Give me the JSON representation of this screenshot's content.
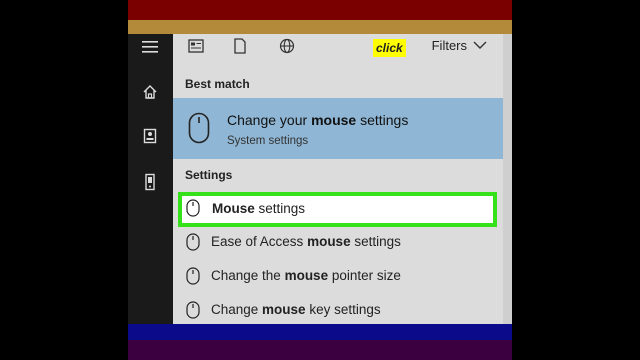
{
  "toolbar": {
    "click_label": "click",
    "filters_label": "Filters",
    "icons": [
      "doc-text-icon",
      "document-icon",
      "globe-icon"
    ]
  },
  "best_match": {
    "heading": "Best match",
    "title_pre": "Change your ",
    "title_bold": "mouse",
    "title_post": " settings",
    "subtitle": "System settings"
  },
  "settings": {
    "heading": "Settings",
    "items": [
      {
        "pre": "",
        "bold": "Mouse",
        "post": " settings"
      },
      {
        "pre": "Ease of Access ",
        "bold": "mouse",
        "post": " settings"
      },
      {
        "pre": "Change the ",
        "bold": "mouse",
        "post": " pointer size"
      },
      {
        "pre": "Change ",
        "bold": "mouse",
        "post": " key settings"
      }
    ]
  },
  "colors": {
    "highlight_border": "#35e21a",
    "best_match_bg": "#8fb6d4",
    "click_badge": "#ffff00"
  }
}
